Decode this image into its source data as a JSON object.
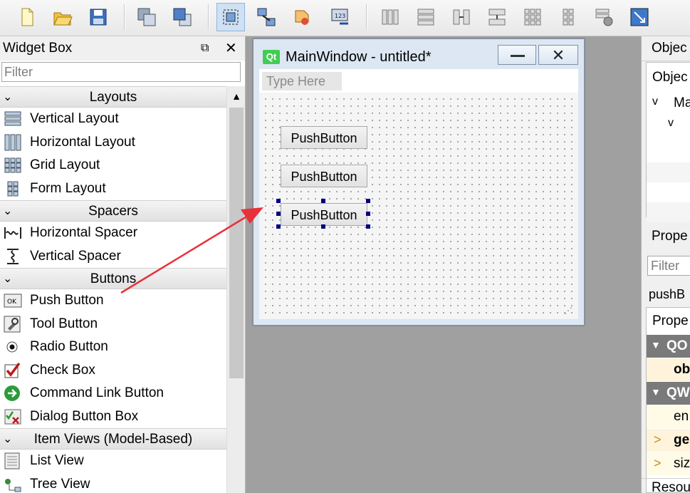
{
  "toolbar": {
    "buttons": [
      "new-file-icon",
      "open-file-icon",
      "save-icon",
      "send-to-back-icon",
      "bring-to-front-icon",
      "edit-widgets-icon",
      "edit-signals-slots-icon",
      "edit-buddies-icon",
      "edit-tab-order-icon",
      "layout-horizontal-icon",
      "layout-vertical-icon",
      "layout-horizontal-splitter-icon",
      "layout-vertical-splitter-icon",
      "layout-grid-icon",
      "layout-form-icon",
      "break-layout-icon",
      "adjust-size-icon"
    ],
    "active": "edit-widgets-icon"
  },
  "widget_box": {
    "title": "Widget Box",
    "float_glyph": "⧉",
    "close_glyph": "✕",
    "filter_placeholder": "Filter",
    "categories": [
      {
        "label": "Layouts",
        "items": [
          {
            "label": "Vertical Layout",
            "icon": "vertical-layout-icon"
          },
          {
            "label": "Horizontal Layout",
            "icon": "horizontal-layout-icon"
          },
          {
            "label": "Grid Layout",
            "icon": "grid-layout-icon"
          },
          {
            "label": "Form Layout",
            "icon": "form-layout-icon"
          }
        ]
      },
      {
        "label": "Spacers",
        "items": [
          {
            "label": "Horizontal Spacer",
            "icon": "horizontal-spacer-icon"
          },
          {
            "label": "Vertical Spacer",
            "icon": "vertical-spacer-icon"
          }
        ]
      },
      {
        "label": "Buttons",
        "items": [
          {
            "label": "Push Button",
            "icon": "push-button-icon"
          },
          {
            "label": "Tool Button",
            "icon": "tool-button-icon"
          },
          {
            "label": "Radio Button",
            "icon": "radio-button-icon"
          },
          {
            "label": "Check Box",
            "icon": "check-box-icon"
          },
          {
            "label": "Command Link Button",
            "icon": "command-link-icon"
          },
          {
            "label": "Dialog Button Box",
            "icon": "dialog-button-box-icon"
          }
        ]
      },
      {
        "label": "Item Views (Model-Based)",
        "items": [
          {
            "label": "List View",
            "icon": "list-view-icon"
          },
          {
            "label": "Tree View",
            "icon": "tree-view-icon"
          }
        ]
      }
    ]
  },
  "form_window": {
    "qt_badge": "Qt",
    "title": "MainWindow - untitled*",
    "close_glyph": "✕",
    "menu_placeholder": "Type Here",
    "buttons": [
      "PushButton",
      "PushButton",
      "PushButton"
    ],
    "selected_index": 2
  },
  "object_inspector": {
    "title": "Objec",
    "header": "Objec",
    "row1": "Ma",
    "row1_chevron": "v",
    "row2_chevron": "v"
  },
  "property_editor": {
    "title": "Prope",
    "filter_placeholder": "Filter",
    "object_name": "pushB",
    "header": "Prope",
    "rows": [
      {
        "type": "cat",
        "label": "QO"
      },
      {
        "type": "prop",
        "label": "ob",
        "bold": true,
        "bg": "#fff3dc"
      },
      {
        "type": "cat",
        "label": "QW"
      },
      {
        "type": "prop",
        "label": "en",
        "bold": false,
        "bg": "#fffbe6"
      },
      {
        "type": "prop",
        "label": "ge",
        "bold": true,
        "bg": "#fff3dc",
        "expand": ">"
      },
      {
        "type": "prop",
        "label": "siz",
        "bold": false,
        "bg": "#fffbe6",
        "expand": ">"
      }
    ]
  },
  "resource": {
    "title": "Resou"
  },
  "colors": {
    "arrow": "#e8303a",
    "selection_handle": "#000080",
    "qt_green": "#41cd52"
  }
}
